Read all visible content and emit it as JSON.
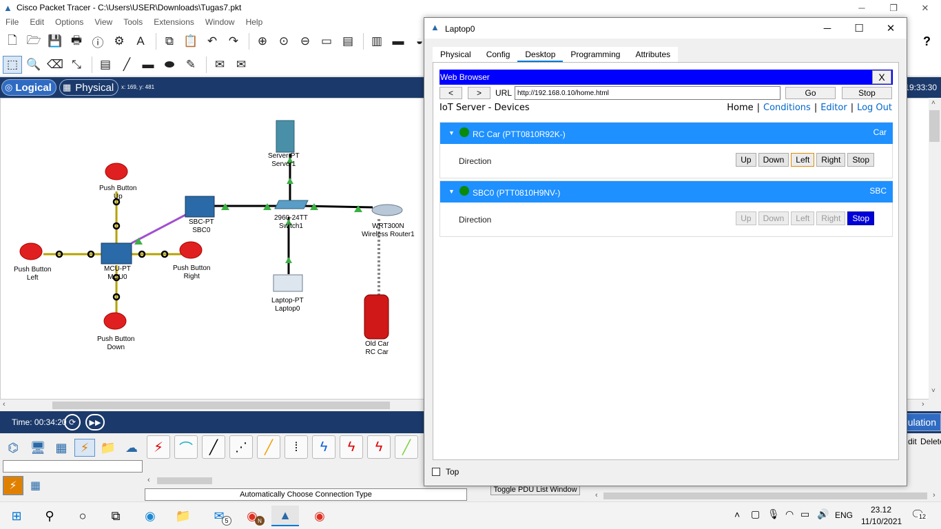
{
  "main_window": {
    "title": "Cisco Packet Tracer - C:\\Users\\USER\\Downloads\\Tugas7.pkt",
    "menu": [
      "File",
      "Edit",
      "Options",
      "View",
      "Tools",
      "Extensions",
      "Window",
      "Help"
    ],
    "help_icon": "?"
  },
  "mode_bar": {
    "logical": "Logical",
    "physical": "Physical",
    "coords": "x: 169, y: 481",
    "clock": "19:33:30"
  },
  "workspace": {
    "devices": [
      {
        "type": "Server-PT",
        "name": "Server1"
      },
      {
        "type": "Push Button",
        "name": "Up"
      },
      {
        "type": "SBC-PT",
        "name": "SBC0"
      },
      {
        "type": "2960-24TT",
        "name": "Switch1"
      },
      {
        "type": "WRT300N",
        "name": "Wireless Router1"
      },
      {
        "type": "Push Button",
        "name": "Left"
      },
      {
        "type": "MCU-PT",
        "name": "MCU0"
      },
      {
        "type": "Push Button",
        "name": "Right"
      },
      {
        "type": "Laptop-PT",
        "name": "Laptop0"
      },
      {
        "type": "Old Car",
        "name": "RC Car"
      },
      {
        "type": "Push Button",
        "name": "Down"
      }
    ]
  },
  "timebar": {
    "time": "Time: 00:34:20",
    "simulation_partial": "ulation"
  },
  "bottom_panel": {
    "connection_status": "Automatically Choose Connection Type",
    "pdu_toggle": "Toggle PDU List Window",
    "edit_partial": "dit",
    "delete_partial": "Delete"
  },
  "taskbar": {
    "time": "23.12",
    "date": "11/10/2021",
    "language": "ENG",
    "mail_badge": "5",
    "chrome_badge": "N",
    "notification_count": "12"
  },
  "dialog": {
    "title": "Laptop0",
    "tabs": [
      "Physical",
      "Config",
      "Desktop",
      "Programming",
      "Attributes"
    ],
    "active_tab": "Desktop",
    "top_checkbox_label": "Top",
    "browser": {
      "title": "Web Browser",
      "close": "X",
      "back": "<",
      "forward": ">",
      "url_label": "URL",
      "url": "http://192.168.0.10/home.html",
      "go": "Go",
      "stop": "Stop",
      "page_title": "IoT Server - Devices",
      "links": {
        "home": "Home",
        "conditions": "Conditions",
        "editor": "Editor",
        "logout": "Log Out"
      },
      "devices": [
        {
          "name": "RC Car (PTT0810R92K-)",
          "type": "Car",
          "status_color": "#0a8a0a",
          "label": "Direction",
          "buttons": [
            "Up",
            "Down",
            "Left",
            "Right",
            "Stop"
          ],
          "focused_button": "Left"
        },
        {
          "name": "SBC0 (PTT0810H9NV-)",
          "type": "SBC",
          "status_color": "#0a8a0a",
          "label": "Direction",
          "buttons": [
            "Up",
            "Down",
            "Left",
            "Right",
            "Stop"
          ],
          "active_button": "Stop"
        }
      ]
    }
  },
  "colors": {
    "browser_titlebar": "#0000ff",
    "device_header": "#1e90ff",
    "mode_bar": "#1b3a6b",
    "active_stop": "#0000d8",
    "link": "#0066cc"
  }
}
